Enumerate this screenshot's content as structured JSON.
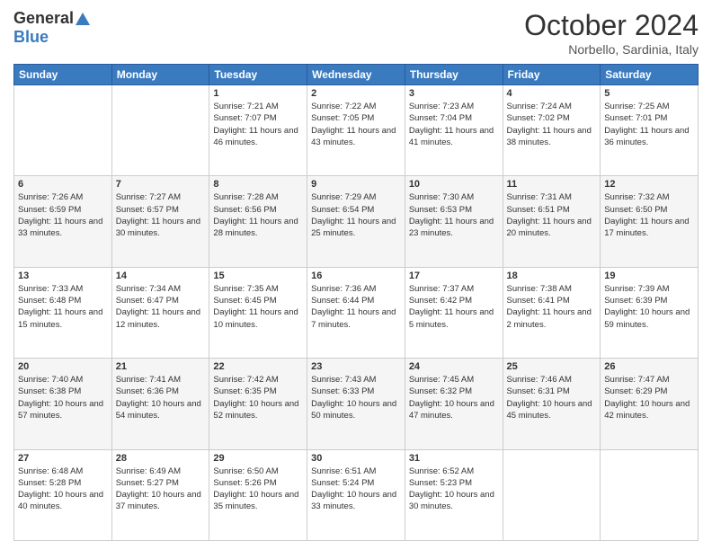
{
  "header": {
    "logo_general": "General",
    "logo_blue": "Blue",
    "month_title": "October 2024",
    "location": "Norbello, Sardinia, Italy"
  },
  "days_of_week": [
    "Sunday",
    "Monday",
    "Tuesday",
    "Wednesday",
    "Thursday",
    "Friday",
    "Saturday"
  ],
  "weeks": [
    [
      {
        "day": "",
        "info": ""
      },
      {
        "day": "",
        "info": ""
      },
      {
        "day": "1",
        "info": "Sunrise: 7:21 AM\nSunset: 7:07 PM\nDaylight: 11 hours and 46 minutes."
      },
      {
        "day": "2",
        "info": "Sunrise: 7:22 AM\nSunset: 7:05 PM\nDaylight: 11 hours and 43 minutes."
      },
      {
        "day": "3",
        "info": "Sunrise: 7:23 AM\nSunset: 7:04 PM\nDaylight: 11 hours and 41 minutes."
      },
      {
        "day": "4",
        "info": "Sunrise: 7:24 AM\nSunset: 7:02 PM\nDaylight: 11 hours and 38 minutes."
      },
      {
        "day": "5",
        "info": "Sunrise: 7:25 AM\nSunset: 7:01 PM\nDaylight: 11 hours and 36 minutes."
      }
    ],
    [
      {
        "day": "6",
        "info": "Sunrise: 7:26 AM\nSunset: 6:59 PM\nDaylight: 11 hours and 33 minutes."
      },
      {
        "day": "7",
        "info": "Sunrise: 7:27 AM\nSunset: 6:57 PM\nDaylight: 11 hours and 30 minutes."
      },
      {
        "day": "8",
        "info": "Sunrise: 7:28 AM\nSunset: 6:56 PM\nDaylight: 11 hours and 28 minutes."
      },
      {
        "day": "9",
        "info": "Sunrise: 7:29 AM\nSunset: 6:54 PM\nDaylight: 11 hours and 25 minutes."
      },
      {
        "day": "10",
        "info": "Sunrise: 7:30 AM\nSunset: 6:53 PM\nDaylight: 11 hours and 23 minutes."
      },
      {
        "day": "11",
        "info": "Sunrise: 7:31 AM\nSunset: 6:51 PM\nDaylight: 11 hours and 20 minutes."
      },
      {
        "day": "12",
        "info": "Sunrise: 7:32 AM\nSunset: 6:50 PM\nDaylight: 11 hours and 17 minutes."
      }
    ],
    [
      {
        "day": "13",
        "info": "Sunrise: 7:33 AM\nSunset: 6:48 PM\nDaylight: 11 hours and 15 minutes."
      },
      {
        "day": "14",
        "info": "Sunrise: 7:34 AM\nSunset: 6:47 PM\nDaylight: 11 hours and 12 minutes."
      },
      {
        "day": "15",
        "info": "Sunrise: 7:35 AM\nSunset: 6:45 PM\nDaylight: 11 hours and 10 minutes."
      },
      {
        "day": "16",
        "info": "Sunrise: 7:36 AM\nSunset: 6:44 PM\nDaylight: 11 hours and 7 minutes."
      },
      {
        "day": "17",
        "info": "Sunrise: 7:37 AM\nSunset: 6:42 PM\nDaylight: 11 hours and 5 minutes."
      },
      {
        "day": "18",
        "info": "Sunrise: 7:38 AM\nSunset: 6:41 PM\nDaylight: 11 hours and 2 minutes."
      },
      {
        "day": "19",
        "info": "Sunrise: 7:39 AM\nSunset: 6:39 PM\nDaylight: 10 hours and 59 minutes."
      }
    ],
    [
      {
        "day": "20",
        "info": "Sunrise: 7:40 AM\nSunset: 6:38 PM\nDaylight: 10 hours and 57 minutes."
      },
      {
        "day": "21",
        "info": "Sunrise: 7:41 AM\nSunset: 6:36 PM\nDaylight: 10 hours and 54 minutes."
      },
      {
        "day": "22",
        "info": "Sunrise: 7:42 AM\nSunset: 6:35 PM\nDaylight: 10 hours and 52 minutes."
      },
      {
        "day": "23",
        "info": "Sunrise: 7:43 AM\nSunset: 6:33 PM\nDaylight: 10 hours and 50 minutes."
      },
      {
        "day": "24",
        "info": "Sunrise: 7:45 AM\nSunset: 6:32 PM\nDaylight: 10 hours and 47 minutes."
      },
      {
        "day": "25",
        "info": "Sunrise: 7:46 AM\nSunset: 6:31 PM\nDaylight: 10 hours and 45 minutes."
      },
      {
        "day": "26",
        "info": "Sunrise: 7:47 AM\nSunset: 6:29 PM\nDaylight: 10 hours and 42 minutes."
      }
    ],
    [
      {
        "day": "27",
        "info": "Sunrise: 6:48 AM\nSunset: 5:28 PM\nDaylight: 10 hours and 40 minutes."
      },
      {
        "day": "28",
        "info": "Sunrise: 6:49 AM\nSunset: 5:27 PM\nDaylight: 10 hours and 37 minutes."
      },
      {
        "day": "29",
        "info": "Sunrise: 6:50 AM\nSunset: 5:26 PM\nDaylight: 10 hours and 35 minutes."
      },
      {
        "day": "30",
        "info": "Sunrise: 6:51 AM\nSunset: 5:24 PM\nDaylight: 10 hours and 33 minutes."
      },
      {
        "day": "31",
        "info": "Sunrise: 6:52 AM\nSunset: 5:23 PM\nDaylight: 10 hours and 30 minutes."
      },
      {
        "day": "",
        "info": ""
      },
      {
        "day": "",
        "info": ""
      }
    ]
  ]
}
